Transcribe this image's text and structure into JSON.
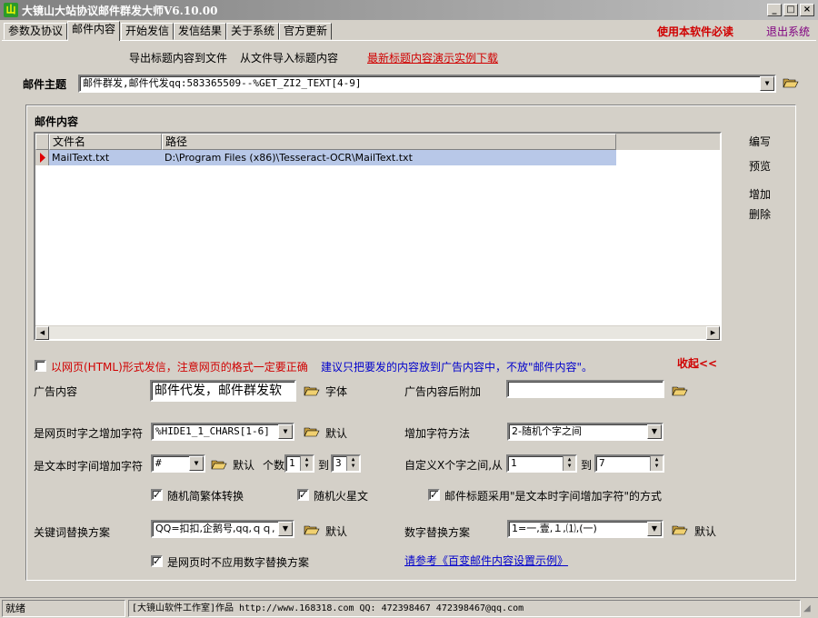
{
  "window": {
    "title": "大镜山大站协议邮件群发大师V6.10.00",
    "minimize": "_",
    "maximize": "□",
    "close": "×"
  },
  "tabs": [
    "参数及协议",
    "邮件内容",
    "开始发信",
    "发信结果",
    "关于系统",
    "官方更新"
  ],
  "header_links": {
    "must_read": "使用本软件必读",
    "exit": "退出系统"
  },
  "toolbar": {
    "export_subject": "导出标题内容到文件",
    "import_subject": "从文件导入标题内容",
    "download_example": "最新标题内容演示实例下载"
  },
  "subject": {
    "label": "邮件主题",
    "value": "邮件群发,邮件代发qq:583365509--%GET_ZI2_TEXT[4-9]"
  },
  "content_group": {
    "label": "邮件内容",
    "columns": [
      "文件名",
      "路径"
    ],
    "rows": [
      {
        "name": "MailText.txt",
        "path": "D:\\Program Files (x86)\\Tesseract-OCR\\MailText.txt"
      }
    ],
    "side_buttons": [
      "编写",
      "预览",
      "增加",
      "删除"
    ]
  },
  "html_option": {
    "label": "以网页(HTML)形式发信，注意网页的格式一定要正确",
    "hint": "建议只把要发的内容放到广告内容中，不放\"邮件内容\"。",
    "collapse": "收起<<"
  },
  "ad": {
    "label": "广告内容",
    "value": "邮件代发，邮件群发软",
    "font_button": "字体",
    "append_label": "广告内容后附加",
    "append_value": ""
  },
  "webpage_chars": {
    "label": "是网页时字之增加字符",
    "value": "%HIDE1_1_CHARS[1-6]",
    "default": "默认"
  },
  "add_method": {
    "label": "增加字符方法",
    "value": "2-随机个字之间"
  },
  "text_chars": {
    "label": "是文本时字间增加字符",
    "value": "#",
    "default": "默认",
    "count_label": "个数",
    "from": "1",
    "to_label": "到",
    "to": "3"
  },
  "custom_between": {
    "label": "自定义X个字之间,从",
    "from": "1",
    "to_label": "到",
    "to": "7"
  },
  "checks": {
    "trad": "随机简繁体转换",
    "mars": "随机火星文",
    "subject_add": "邮件标题采用\"是文本时字间增加字符\"的方式",
    "no_digit_replace": "是网页时不应用数字替换方案"
  },
  "keyword": {
    "label": "关键词替换方案",
    "value": "QQ=扣扣,企鹅号,qq,ｑｑ,",
    "default": "默认"
  },
  "digit": {
    "label": "数字替换方案",
    "value": "1=一,壹,１,⑴,(一)",
    "default": "默认"
  },
  "example_link": "请参考《百变邮件内容设置示例》",
  "status": {
    "ready": "就绪",
    "info": "[大镜山软件工作室]作品 http://www.168318.com QQ: 472398467 472398467@qq.com"
  },
  "colors": {
    "red": "#d00000",
    "blue": "#0000cc",
    "selection": "#b8c8e8"
  }
}
